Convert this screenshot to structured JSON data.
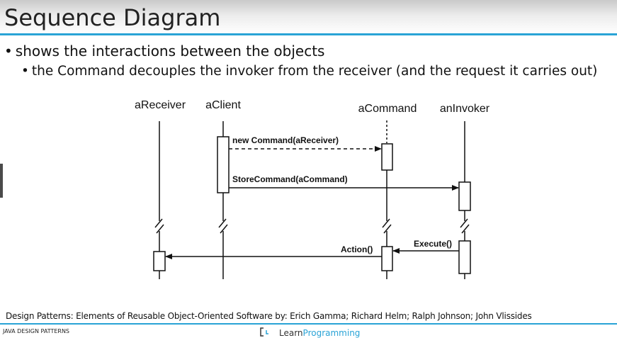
{
  "slide": {
    "title": "Sequence Diagram",
    "bullet_1": "shows the interactions between the objects",
    "bullet_2": "the Command decouples the invoker from the receiver (and the request it carries out)",
    "bullet_glyph": "•",
    "credit": "Design Patterns: Elements of Reusable Object-Oriented Software by: Erich Gamma; Richard Helm; Ralph Johnson; John Vlissides",
    "footer_left": "JAVA DESIGN PATTERNS",
    "logo_part1": "Learn",
    "logo_part2": "Programming",
    "logo_icon": "lp-bracket-logo-icon",
    "accent_color": "#29a3d6"
  },
  "diagram": {
    "objects": [
      "aReceiver",
      "aClient",
      "aCommand",
      "anInvoker"
    ],
    "messages": [
      {
        "label": "new Command(aReceiver)",
        "from": "aClient",
        "to": "aCommand",
        "style": "dashed"
      },
      {
        "label": "StoreCommand(aCommand)",
        "from": "aClient",
        "to": "anInvoker",
        "style": "solid"
      },
      {
        "label": "Execute()",
        "from": "anInvoker",
        "to": "aCommand",
        "style": "solid"
      },
      {
        "label": "Action()",
        "from": "aCommand",
        "to": "aReceiver",
        "style": "solid"
      }
    ]
  }
}
